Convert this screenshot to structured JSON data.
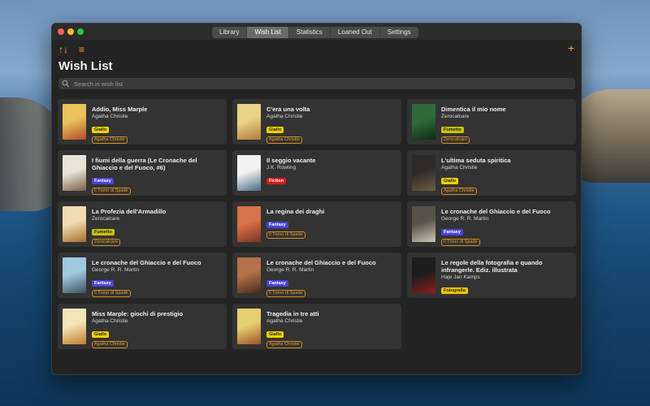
{
  "window": {
    "tabs": [
      "Library",
      "Wish List",
      "Statistics",
      "Loaned Out",
      "Settings"
    ],
    "active_tab": "Wish List"
  },
  "toolbar": {
    "sort_icon": "↑↓",
    "filter_icon": "≡",
    "add_icon": "+"
  },
  "page": {
    "title": "Wish List",
    "search_placeholder": "Search in wish list"
  },
  "books": [
    {
      "title": "Addio, Miss Marple",
      "author": "Agatha Christie",
      "genre": "Giallo",
      "tag": "Agatha Christie",
      "cover": [
        "#e8c25a",
        "#b6492a"
      ]
    },
    {
      "title": "C'era una volta",
      "author": "Agatha Christie",
      "genre": "Giallo",
      "tag": "Agatha Christie",
      "cover": [
        "#ead287",
        "#b07a3c"
      ]
    },
    {
      "title": "Dimentica il mio nome",
      "author": "Zerocalcare",
      "genre": "Fumetto",
      "tag": "Zerocalcare",
      "cover": [
        "#2f6b3a",
        "#0f2a17"
      ]
    },
    {
      "title": "I fiumi della guerra (Le Cronache del Ghiaccio e del Fuoco, #6)",
      "author": "",
      "genre": "Fantasy",
      "tag": "Il Trono di Spade",
      "cover": [
        "#e9e4da",
        "#7b5e42"
      ]
    },
    {
      "title": "Il seggio vacante",
      "author": "J.K. Rowling",
      "genre": "Fiction",
      "tag": "",
      "cover": [
        "#f2f2f2",
        "#4c6a86"
      ]
    },
    {
      "title": "L'ultima seduta spiritica",
      "author": "Agatha Christie",
      "genre": "Giallo",
      "tag": "Agatha Christie",
      "cover": [
        "#2d2a28",
        "#6e5d45"
      ]
    },
    {
      "title": "La Profezia dell'Armadillo",
      "author": "Zerocalcare",
      "genre": "Fumetto",
      "tag": "Zerocalcare",
      "cover": [
        "#f0dcb0",
        "#a96f2d"
      ]
    },
    {
      "title": "La regina dei draghi",
      "author": "",
      "genre": "Fantasy",
      "tag": "Il Trono di Spade",
      "cover": [
        "#d9724a",
        "#7c3320"
      ]
    },
    {
      "title": "Le cronache del Ghiaccio e del Fuoco",
      "author": "George R. R. Martin",
      "genre": "Fantasy",
      "tag": "Il Trono di Spade",
      "cover": [
        "#58524a",
        "#cfc7b8"
      ]
    },
    {
      "title": "Le cronache del Ghiaccio e del Fuoco",
      "author": "George R. R. Martin",
      "genre": "Fantasy",
      "tag": "Il Trono di Spade",
      "cover": [
        "#9ec9df",
        "#3f4f5c"
      ]
    },
    {
      "title": "Le cronache del Ghiaccio e del Fuoco",
      "author": "George R. R. Martin",
      "genre": "Fantasy",
      "tag": "Il Trono di Spade",
      "cover": [
        "#b5714a",
        "#4a2b1e"
      ]
    },
    {
      "title": "Le regole della fotografia e quando infrangerle. Ediz. illustrata",
      "author": "Haje Jan Kamps",
      "genre": "Fotografia",
      "tag": "",
      "cover": [
        "#1d1d1d",
        "#8b1c1c"
      ]
    },
    {
      "title": "Miss Marple: giochi di prestigio",
      "author": "Agatha Christie",
      "genre": "Giallo",
      "tag": "Agatha Christie",
      "cover": [
        "#f2e6b8",
        "#c07a2c"
      ]
    },
    {
      "title": "Tragedia in tre atti",
      "author": "Agatha Christie",
      "genre": "Giallo",
      "tag": "Agatha Christie",
      "cover": [
        "#e7d072",
        "#a0512a"
      ]
    }
  ]
}
